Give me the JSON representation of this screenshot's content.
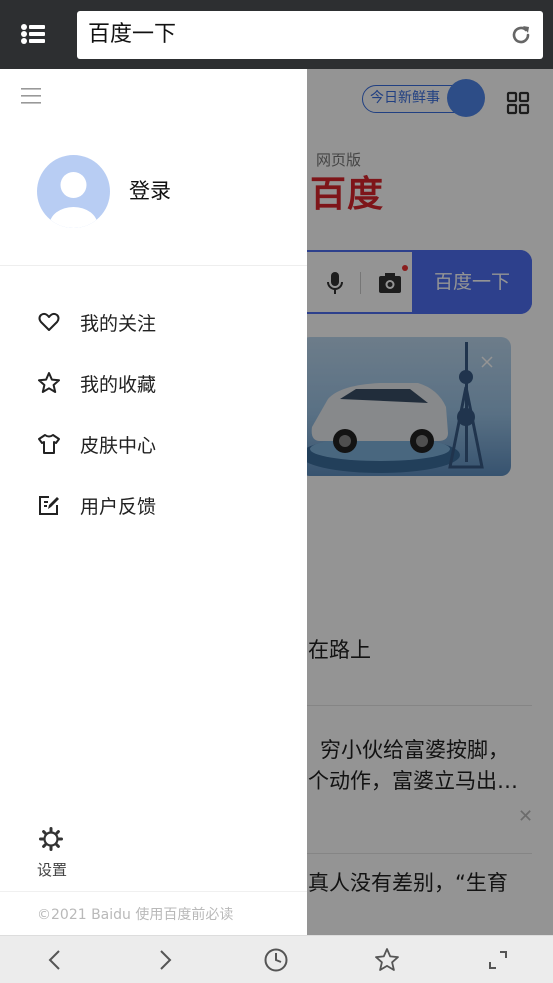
{
  "browser": {
    "url_text": "百度一下",
    "menu_icon": "list-menu-icon",
    "reload_icon": "refresh-icon"
  },
  "background_page": {
    "today_badge": "今日新鲜事",
    "web_version": "网页版",
    "logo_text": "百度",
    "search_button": "百度一下",
    "news": [
      {
        "line1": "在路上"
      },
      {
        "line1": "穷小伙给富婆按脚，",
        "line2": "个动作，富婆立马出…"
      },
      {
        "line1": "真人没有差别，“生育"
      }
    ],
    "close_symbol": "✕"
  },
  "drawer": {
    "login_label": "登录",
    "menu": [
      {
        "label": "我的关注",
        "icon": "heart-icon"
      },
      {
        "label": "我的收藏",
        "icon": "star-icon"
      },
      {
        "label": "皮肤中心",
        "icon": "tshirt-icon"
      },
      {
        "label": "用户反馈",
        "icon": "feedback-edit-icon"
      }
    ],
    "settings_label": "设置",
    "copyright": "©2021 Baidu 使用百度前必读"
  },
  "toolbar": {
    "icons": [
      "back-icon",
      "forward-icon",
      "history-icon",
      "bookmark-star-icon",
      "fullscreen-icon"
    ]
  },
  "colors": {
    "accent_blue": "#4e6ef2",
    "baidu_red": "#d9252b",
    "topbar": "#2d2f31"
  }
}
